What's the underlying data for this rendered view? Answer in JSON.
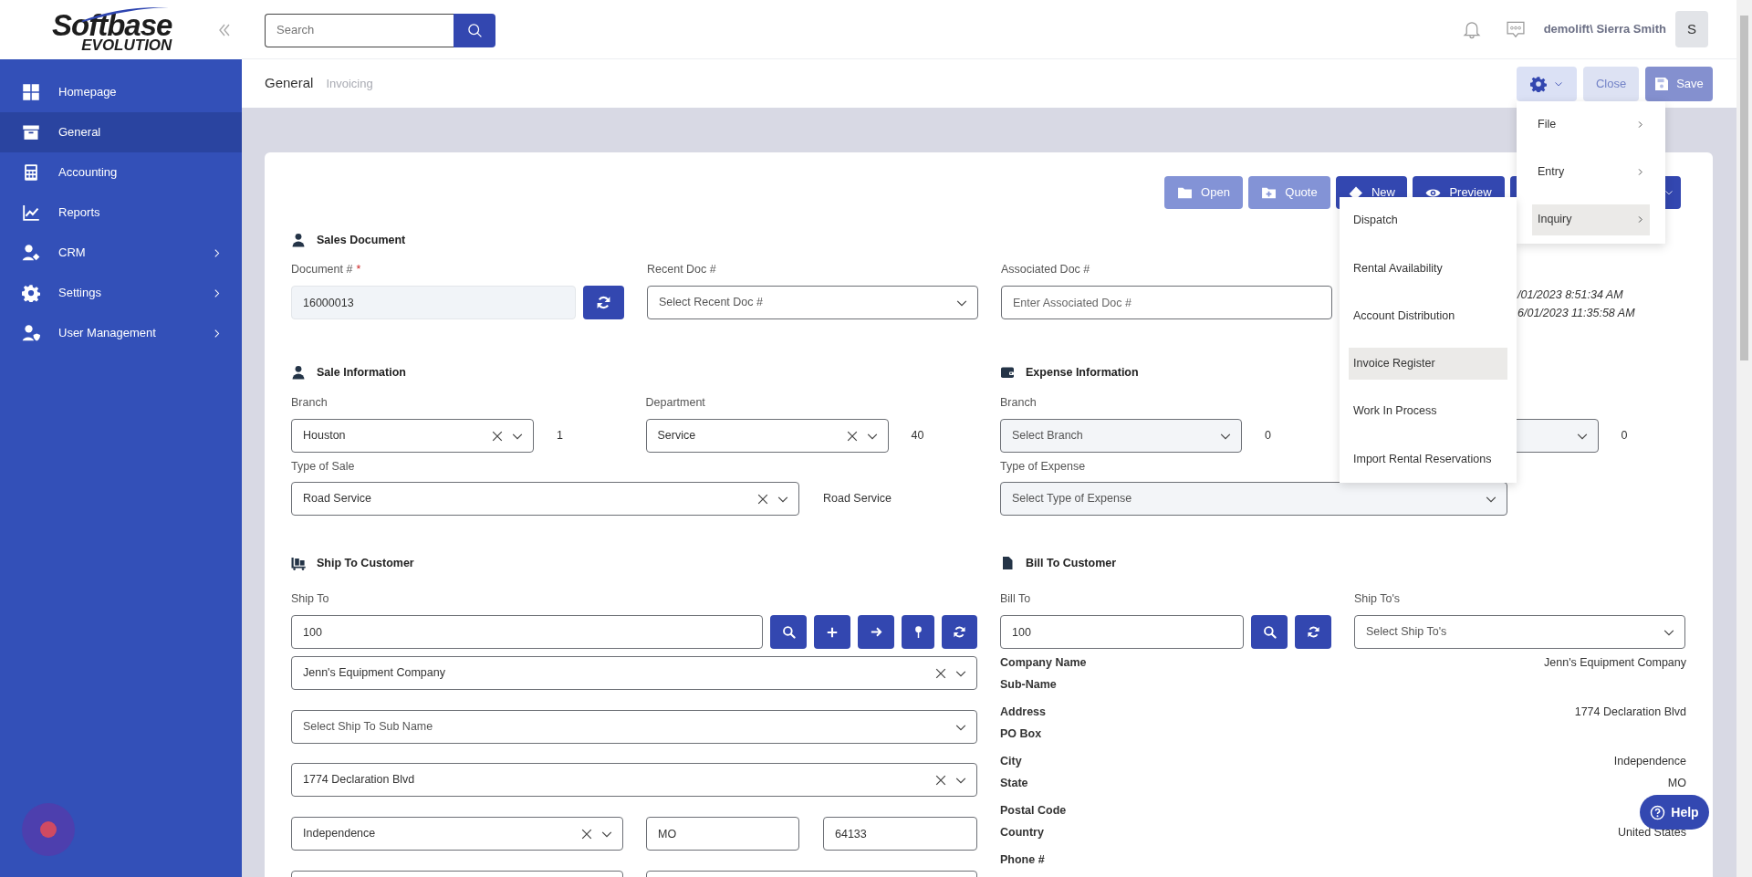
{
  "logo": {
    "name": "Softbase",
    "subtitle": "EVOLUTION"
  },
  "sidebar": {
    "items": [
      {
        "label": "Homepage",
        "selected": false,
        "has_submenu": false
      },
      {
        "label": "General",
        "selected": true,
        "has_submenu": false
      },
      {
        "label": "Accounting",
        "selected": false,
        "has_submenu": false
      },
      {
        "label": "Reports",
        "selected": false,
        "has_submenu": false
      },
      {
        "label": "CRM",
        "selected": false,
        "has_submenu": true
      },
      {
        "label": "Settings",
        "selected": false,
        "has_submenu": true
      },
      {
        "label": "User Management",
        "selected": false,
        "has_submenu": true
      }
    ]
  },
  "search": {
    "placeholder": "Search"
  },
  "user": {
    "name": "demolift\\ Sierra Smith",
    "initial": "S"
  },
  "breadcrumb": [
    {
      "label": "General",
      "selected": true
    },
    {
      "label": "Invoicing",
      "selected": false
    }
  ],
  "header_buttons": [
    {
      "kind": "settings",
      "disabled": false
    },
    {
      "kind": "close",
      "label": "Close",
      "disabled": false
    },
    {
      "kind": "save",
      "label": "Save",
      "disabled": true
    }
  ],
  "settings_menu": {
    "items": [
      {
        "label": "File",
        "selected": false
      },
      {
        "label": "Entry",
        "selected": false
      },
      {
        "label": "Inquiry",
        "selected": true
      }
    ]
  },
  "inquiry_menu": {
    "items": [
      {
        "label": "Dispatch",
        "selected": false
      },
      {
        "label": "Rental Availability",
        "selected": false
      },
      {
        "label": "Account Distribution",
        "selected": false
      },
      {
        "label": "Invoice Register",
        "selected": true
      },
      {
        "label": "Work In Process",
        "selected": false
      },
      {
        "label": "Import Rental Reservations",
        "selected": false
      }
    ]
  },
  "toolbar": [
    {
      "label": "Open",
      "disabled": true
    },
    {
      "label": "Quote",
      "disabled": true
    },
    {
      "label": "New",
      "disabled": false
    },
    {
      "label": "Preview",
      "disabled": false
    },
    {
      "disabled": false
    }
  ],
  "sales_document": {
    "title": "Sales Document",
    "document_number": {
      "label": "Document #",
      "required_mark": "*",
      "value": "16000013"
    },
    "recent_doc": {
      "label": "Recent Doc #",
      "placeholder": "Select Recent Doc #"
    },
    "associated_doc": {
      "label": "Associated Doc #",
      "placeholder": "Enter Associated Doc #"
    },
    "timestamps": [
      "/01/2023 8:51:34 AM",
      "6/01/2023 11:35:58 AM"
    ]
  },
  "sale_information": {
    "title": "Sale Information",
    "branch": {
      "label": "Branch",
      "value": "Houston",
      "code": "1"
    },
    "department": {
      "label": "Department",
      "value": "Service",
      "code": "40"
    },
    "type_of_sale": {
      "label": "Type of Sale",
      "value": "Road Service",
      "description": "Road Service"
    }
  },
  "expense_information": {
    "title": "Expense Information",
    "branch": {
      "label": "Branch",
      "placeholder": "Select Branch",
      "code": "0"
    },
    "department": {
      "code": "0"
    },
    "type_of_expense": {
      "label": "Type of Expense",
      "placeholder": "Select Type of Expense"
    }
  },
  "ship_to_customer": {
    "title": "Ship To Customer",
    "ship_to": {
      "label": "Ship To",
      "value": "100"
    },
    "selects": [
      {
        "value": "Jenn's Equipment Company"
      },
      {
        "placeholder": "Select Ship To Sub Name"
      },
      {
        "value": "1774 Declaration Blvd"
      }
    ],
    "city": "Independence",
    "state": "MO",
    "postal_code": "64133"
  },
  "bill_to_customer": {
    "title": "Bill To Customer",
    "bill_to": {
      "label": "Bill To",
      "value": "100"
    },
    "ship_tos": {
      "label": "Ship To's",
      "placeholder": "Select Ship To's"
    },
    "details": [
      {
        "label": "Company Name",
        "value": "Jenn's Equipment Company"
      },
      {
        "label": "Sub-Name"
      },
      {
        "label": "Address",
        "value": "1774 Declaration Blvd"
      },
      {
        "label": "PO Box"
      },
      {
        "label": "City",
        "value": "Independence"
      },
      {
        "label": "State",
        "value": "MO"
      },
      {
        "label": "Postal Code"
      },
      {
        "label": "Country",
        "value": "United States"
      },
      {
        "label": "Phone #"
      }
    ]
  },
  "help": {
    "label": "Help"
  }
}
